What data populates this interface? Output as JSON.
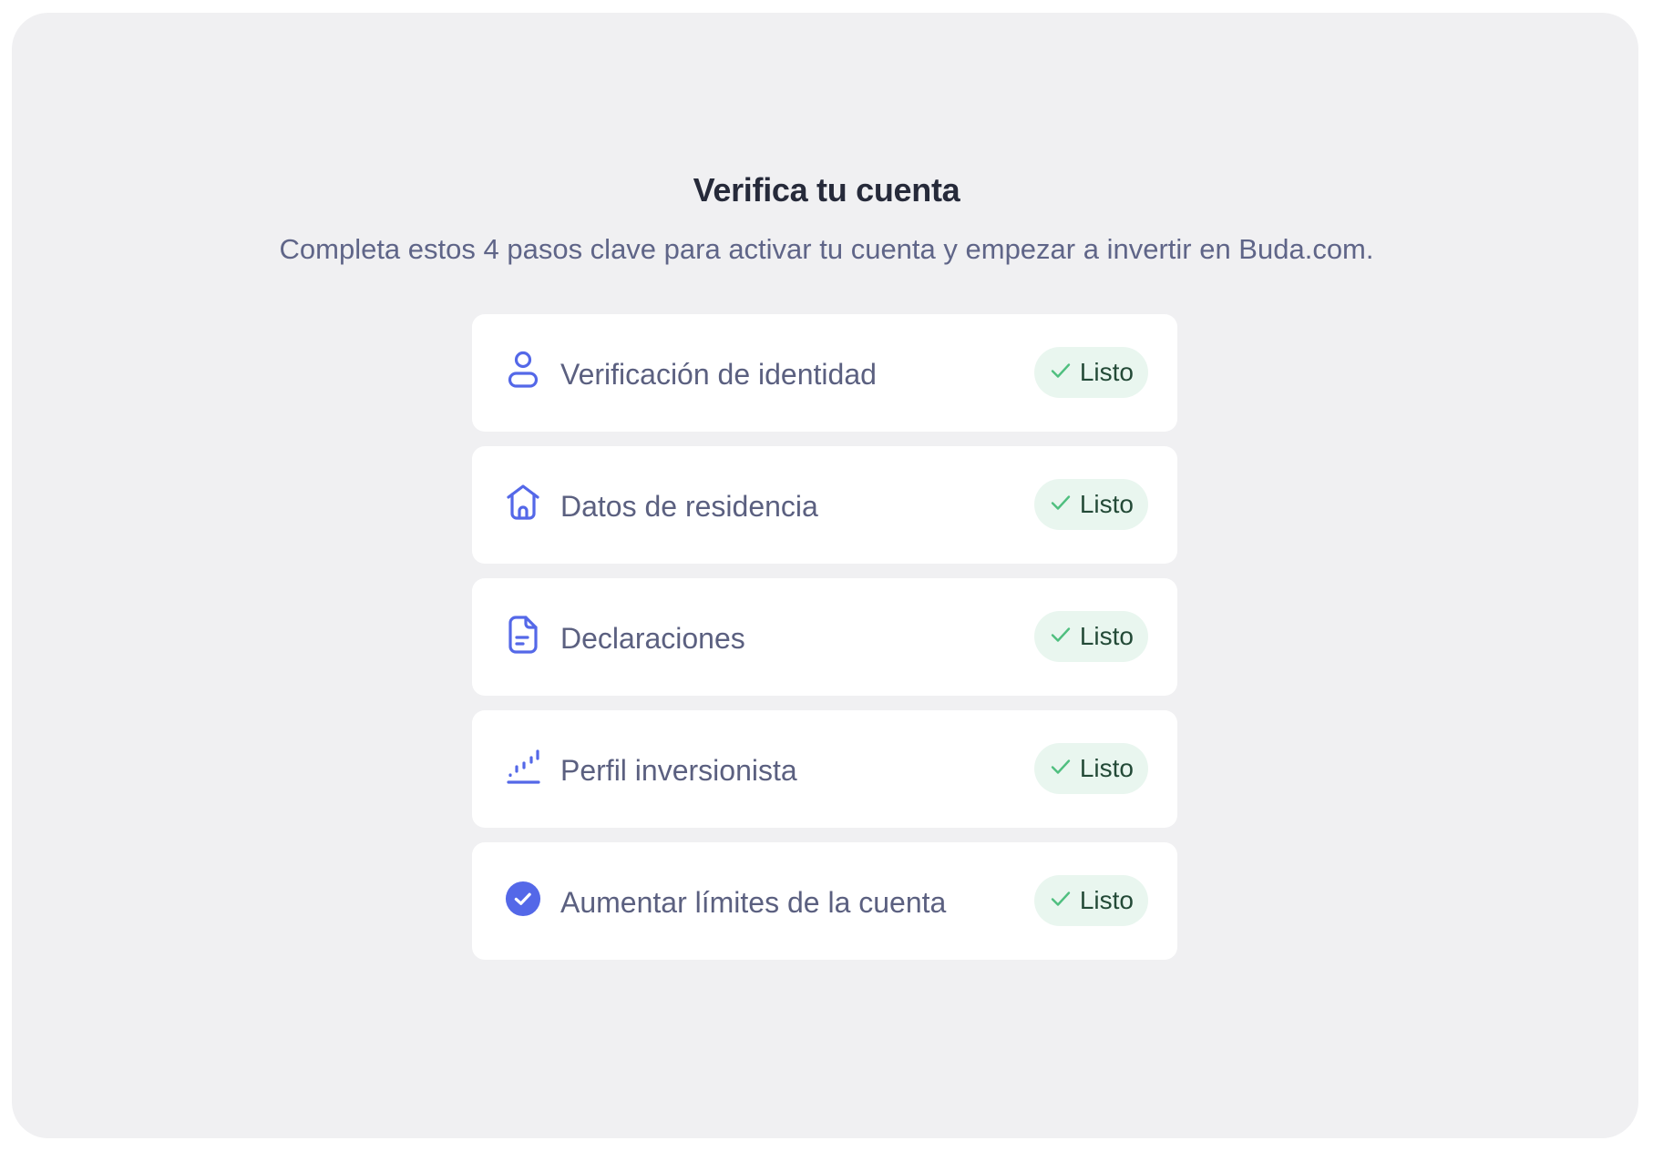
{
  "header": {
    "title": "Verifica tu cuenta",
    "subtitle": "Completa estos 4 pasos clave para activar tu cuenta y empezar a invertir en Buda.com."
  },
  "colors": {
    "accent": "#5468e8",
    "badge_bg": "#e9f6ef",
    "badge_check": "#4fbf7f",
    "badge_text": "#234a37"
  },
  "steps": [
    {
      "icon": "user-icon",
      "label": "Verificación de identidad",
      "status": "Listo"
    },
    {
      "icon": "home-icon",
      "label": "Datos de residencia",
      "status": "Listo"
    },
    {
      "icon": "document-icon",
      "label": "Declaraciones",
      "status": "Listo"
    },
    {
      "icon": "chart-icon",
      "label": "Perfil inversionista",
      "status": "Listo"
    },
    {
      "icon": "check-circle-icon",
      "label": "Aumentar límites de la cuenta",
      "status": "Listo"
    }
  ]
}
